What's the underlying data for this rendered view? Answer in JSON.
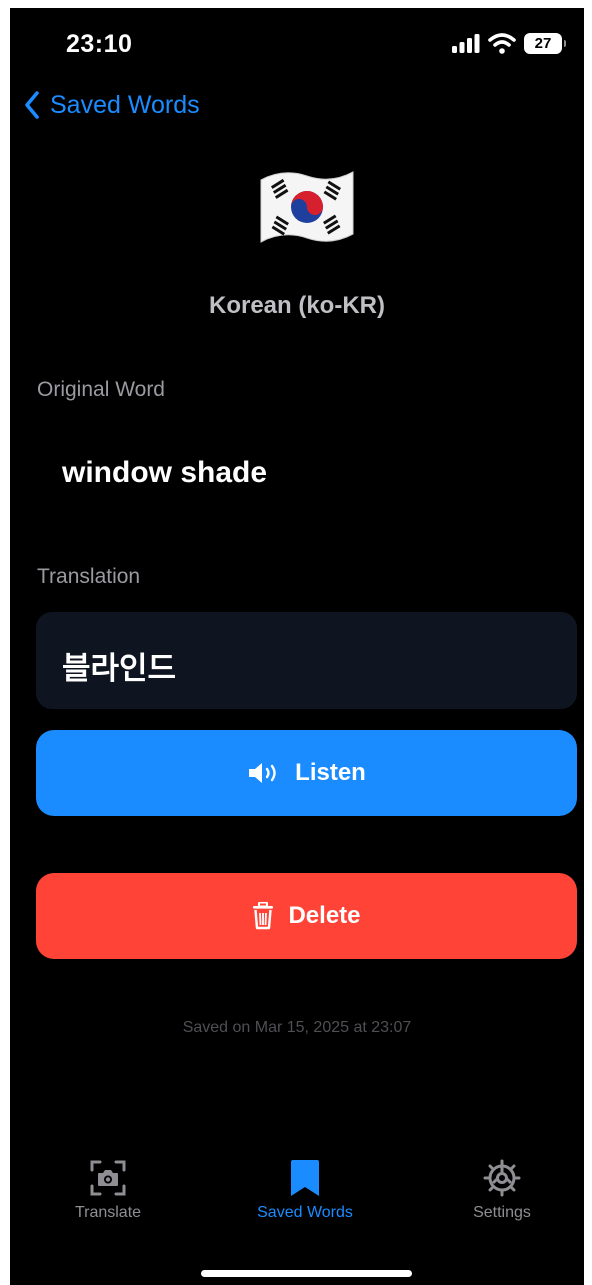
{
  "status_bar": {
    "time": "23:10",
    "battery": "27"
  },
  "nav": {
    "back_label": "Saved Words"
  },
  "word": {
    "language": "Korean (ko-KR)",
    "original_label": "Original Word",
    "original": "window shade",
    "translation_label": "Translation",
    "translation": "블라인드"
  },
  "actions": {
    "listen_label": "Listen",
    "delete_label": "Delete"
  },
  "saved_on": "Saved on Mar 15, 2025 at 23:07",
  "tabs": [
    {
      "label": "Translate",
      "icon": "camera-icon"
    },
    {
      "label": "Saved Words",
      "icon": "bookmark-icon"
    },
    {
      "label": "Settings",
      "icon": "gear-icon"
    }
  ],
  "colors": {
    "accent": "#1a8cff",
    "danger": "#ff4337",
    "background": "#000000",
    "card": "#0e1520"
  }
}
